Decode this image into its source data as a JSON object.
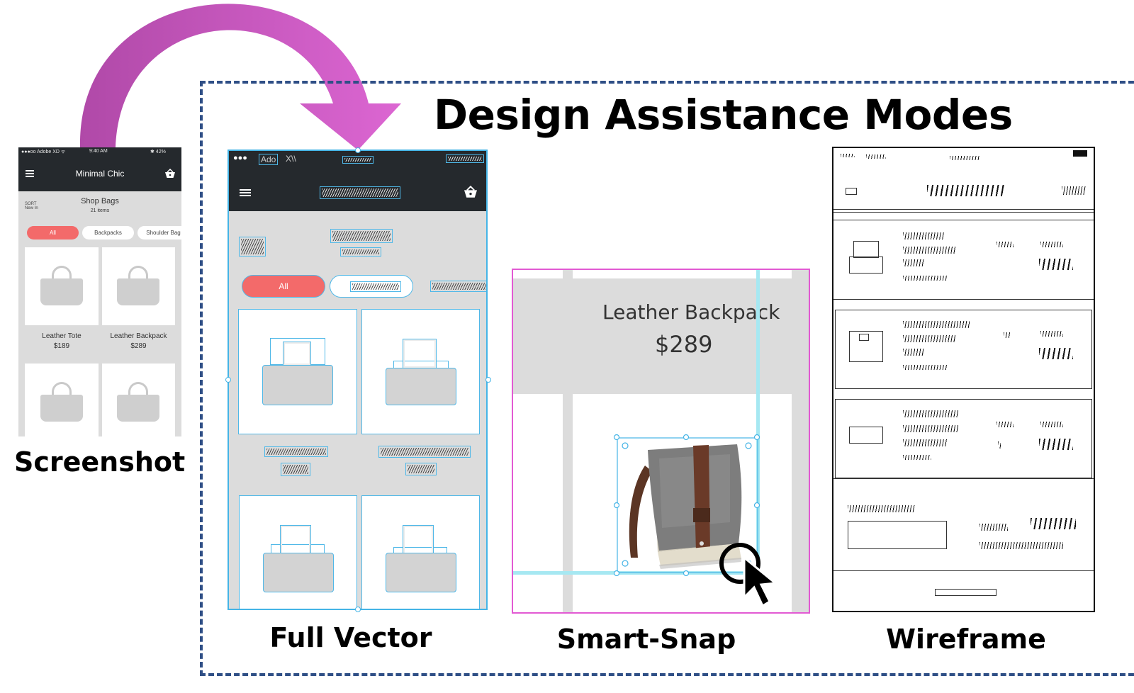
{
  "title": "Design Assistance Modes",
  "labels": {
    "screenshot": "Screenshot",
    "full_vector": "Full Vector",
    "smart_snap": "Smart-Snap",
    "wireframe": "Wireframe"
  },
  "phone": {
    "status_left": "●●●oo Adobe XD ᯤ",
    "status_time": "9:40 AM",
    "status_right": "✱ 42%",
    "app_title": "Minimal Chic",
    "sort_label": "SORT",
    "sort_value": "New In",
    "page_title": "Shop Bags",
    "item_count": "21 items",
    "filters": [
      "All",
      "Backpacks",
      "Shoulder Bag"
    ],
    "products": [
      {
        "name": "Leather Tote",
        "price": "$189"
      },
      {
        "name": "Leather Backpack",
        "price": "$289"
      }
    ]
  },
  "full_vector": {
    "status_left": "●●●",
    "status_ado": "Ado",
    "status_x": "X\\\\",
    "filter_all": "All"
  },
  "smart_snap": {
    "product_name": "Leather Backpack",
    "product_price": "$289"
  },
  "colors": {
    "accent_arrow": "#d65ec9",
    "dashed_frame": "#2f4f86",
    "nav_dark": "#25292d",
    "pill_active": "#f36a6a",
    "vector_outline": "#45b4e6",
    "snap_frame": "#e25ad3",
    "snap_guide": "#a6e8f2"
  }
}
